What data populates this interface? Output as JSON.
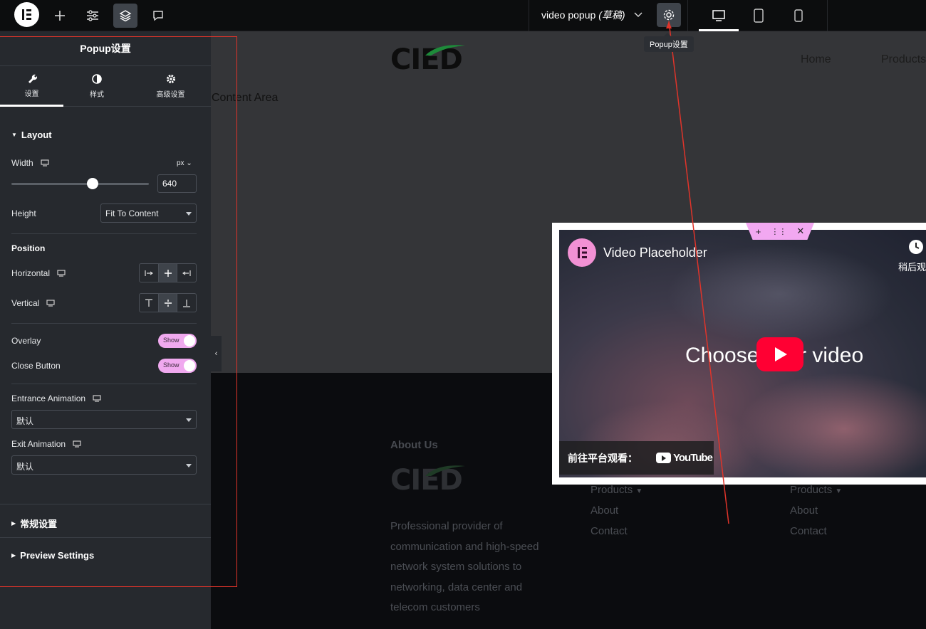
{
  "topbar": {
    "doc_title": "video popup",
    "doc_status": "(草稿)",
    "tooltip": "Popup设置"
  },
  "panel": {
    "title": "Popup设置",
    "tabs": [
      {
        "label": "设置",
        "icon": "wrench-icon"
      },
      {
        "label": "样式",
        "icon": "contrast-icon"
      },
      {
        "label": "高级设置",
        "icon": "gear-icon"
      }
    ],
    "layout": {
      "heading": "Layout",
      "width_label": "Width",
      "width_unit": "px",
      "width_value": "640",
      "width_slider_fraction": 0.59,
      "height_label": "Height",
      "height_value": "Fit To Content"
    },
    "position": {
      "heading": "Position",
      "horizontal_label": "Horizontal",
      "vertical_label": "Vertical"
    },
    "overlay_label": "Overlay",
    "overlay_toggle": "Show",
    "close_label": "Close Button",
    "close_toggle": "Show",
    "entrance_label": "Entrance Animation",
    "entrance_value": "默认",
    "exit_label": "Exit Animation",
    "exit_value": "默认",
    "general_section": "常规设置",
    "preview_section": "Preview Settings"
  },
  "canvas": {
    "logo_text": "CIED",
    "nav": [
      "Home",
      "Products"
    ],
    "content_area": "Content Area",
    "footer": {
      "about_heading": "About Us",
      "about_text": [
        "Professional provider of",
        "communication and high-speed",
        "network system solutions to",
        "networking, data center and",
        "telecom customers"
      ],
      "col1_links": [
        "Products",
        "About",
        "Contact"
      ],
      "col2_links": [
        "Products",
        "About",
        "Contact"
      ]
    }
  },
  "popup": {
    "video_title": "Video Placeholder",
    "watch_later": "稍后观",
    "choose_text": "Choose your video",
    "watch_on": "前往平台观看：",
    "youtube": "YouTube"
  },
  "colors": {
    "accent_pink": "#f2a8f1",
    "youtube_red": "#ff0033",
    "annotation_red": "#e0342a"
  }
}
